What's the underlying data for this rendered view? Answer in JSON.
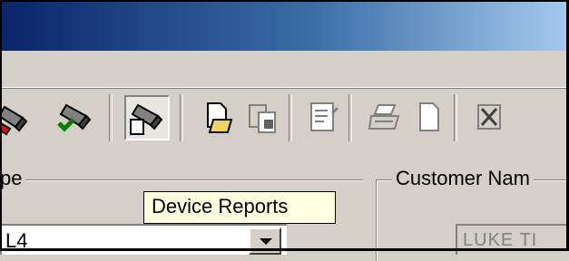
{
  "toolbar": {
    "buttons": [
      {
        "icon": "device-icon-red",
        "interactable": true
      },
      {
        "icon": "device-ok-icon",
        "interactable": true
      },
      {
        "icon": "device-reports-icon",
        "pressed": true
      },
      {
        "icon": "new-document-icon"
      },
      {
        "icon": "paste-icon"
      },
      {
        "icon": "properties-icon"
      },
      {
        "icon": "print-icon"
      },
      {
        "icon": "blank-page-icon"
      },
      {
        "icon": "close-tool-icon"
      }
    ]
  },
  "tooltip": {
    "text": "Device Reports"
  },
  "left_group": {
    "label": "pe",
    "combo_value": "L4"
  },
  "customer_group": {
    "label": "Customer Nam",
    "field_value": "LUKE TI"
  },
  "colors": {
    "title_start": "#0a246a",
    "title_end": "#a6caf0",
    "face": "#d4d0c8",
    "tooltip_bg": "#ffffe1"
  }
}
